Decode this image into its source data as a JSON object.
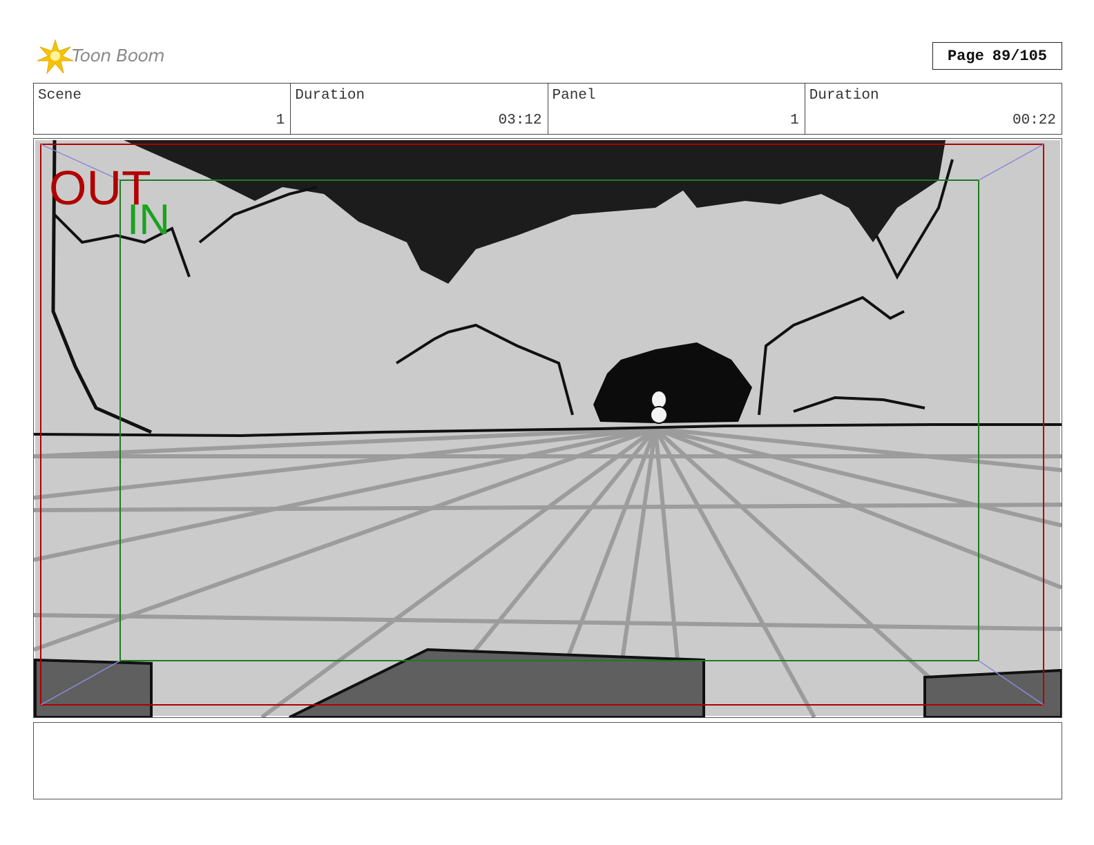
{
  "brand": {
    "name": "Toon Boom",
    "star_color": "#f5c400"
  },
  "page": {
    "label": "Page",
    "value": "89/105"
  },
  "info": {
    "scene_label": "Scene",
    "scene_value": "1",
    "scene_duration_label": "Duration",
    "scene_duration_value": "03:12",
    "panel_label": "Panel",
    "panel_value": "1",
    "panel_duration_label": "Duration",
    "panel_duration_value": "00:22"
  },
  "panel": {
    "out_label": "OUT",
    "out_color": "#b00000",
    "in_label": "IN",
    "in_color": "#19a31f"
  },
  "notes": {
    "text": ""
  }
}
